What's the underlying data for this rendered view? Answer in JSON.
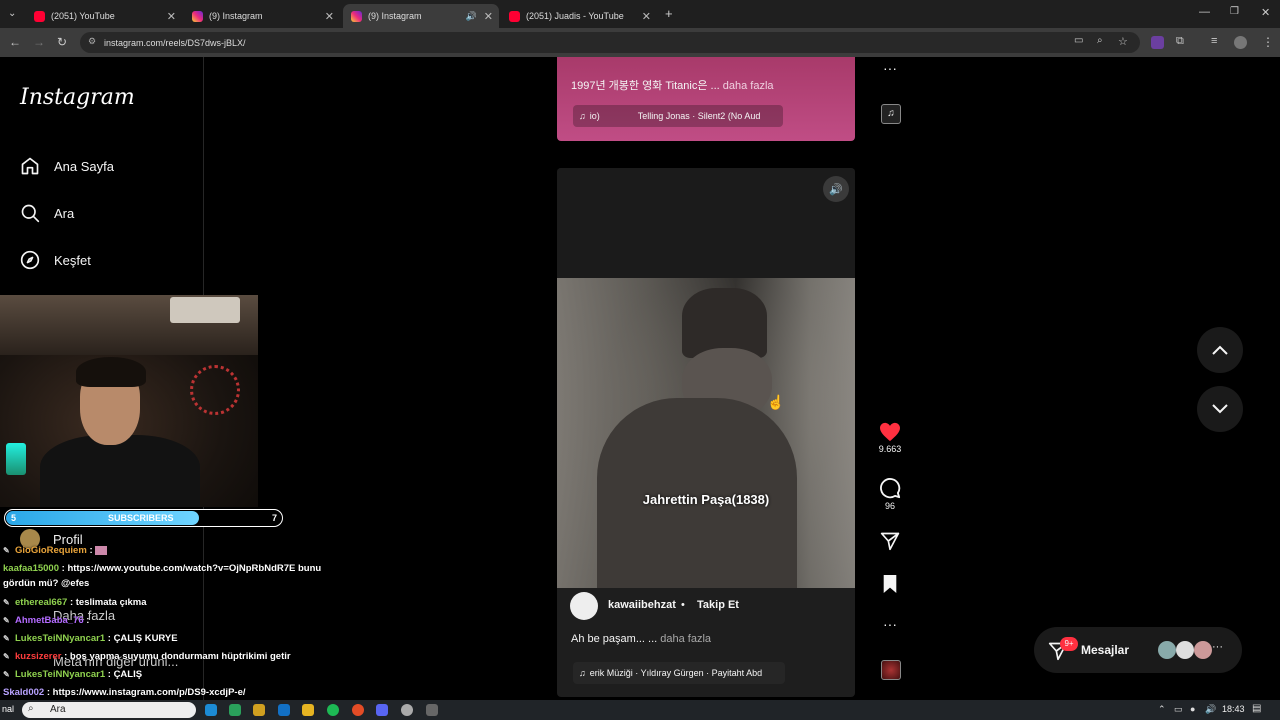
{
  "browser": {
    "tabs": [
      {
        "label": "(2051) YouTube",
        "favicon": "youtube-icon"
      },
      {
        "label": "(9) Instagram",
        "favicon": "instagram-icon"
      },
      {
        "label": "(9) Instagram",
        "favicon": "instagram-icon",
        "active": true
      },
      {
        "label": "(2051) Juadis - YouTube",
        "favicon": "youtube-icon"
      }
    ],
    "url": "instagram.com/reels/DS7dws-jBLX/"
  },
  "sidebar": {
    "logo": "Instagram",
    "items": [
      {
        "label": "Ana Sayfa",
        "icon": "home-icon"
      },
      {
        "label": "Ara",
        "icon": "search-icon"
      },
      {
        "label": "Keşfet",
        "icon": "compass-icon"
      }
    ],
    "profile_label": "Profil",
    "more_label": "Daha fazla",
    "meta_label": "Meta'nın diğer ürünl..."
  },
  "stream_overlay": {
    "sub_goal": {
      "current": "5",
      "label": "SUBSCRIBERS",
      "target": "7",
      "progress": 0.7
    },
    "chat": [
      {
        "user": "GioGioRequiem",
        "text": ":",
        "color": "#e8a33a"
      },
      {
        "user": "kaafaa15000",
        "text": ": https://www.youtube.com/watch?v=OjNpRbNdR7E bunu",
        "color": "#8fd14f"
      },
      {
        "user": "",
        "text": "gördün mü? @efes",
        "color": "#ffffff"
      },
      {
        "user": "ethereal667",
        "text": ": teslimata çıkma",
        "color": "#8fd14f"
      },
      {
        "user": "AhmetBaba_76",
        "text": ":",
        "color": "#b36bff"
      },
      {
        "user": "LukesTeiNNyancar1",
        "text": ": ÇALIŞ KURYE",
        "color": "#8fd14f"
      },
      {
        "user": "kuzsizerer",
        "text": ": boş yapma suyumu dondurmamı hüptrikimi getir",
        "color": "#ff3d3d"
      },
      {
        "user": "LukesTeiNNyancar1",
        "text": ": ÇALIŞ",
        "color": "#8fd14f"
      },
      {
        "user": "Skald002",
        "text": ": https://www.instagram.com/p/DS9-xcdjP-e/",
        "color": "#b8a2ff"
      }
    ]
  },
  "reel_prev": {
    "caption": "1997년 개봉한 영화 Titanic은 ...",
    "more": "daha fazla",
    "music_left": "io)",
    "music": "Telling Jonas · Silent2 (No Aud"
  },
  "reel_main": {
    "overlay_text": "Jahrettin Paşa(1838)",
    "username": "kawaiibehzat",
    "follow": "Takip Et",
    "caption": "Ah be paşam... ...",
    "more": "daha fazla",
    "music": "erik Müziği · Yıldıray Gürgen · Payitaht Abd",
    "likes": "9.663",
    "comments": "96"
  },
  "messages": {
    "label": "Mesajlar",
    "badge": "9+"
  },
  "taskbar": {
    "search": "Ara",
    "time": "18:43"
  },
  "colors": {
    "like": "#ff3040",
    "accent": "#0095f6"
  }
}
